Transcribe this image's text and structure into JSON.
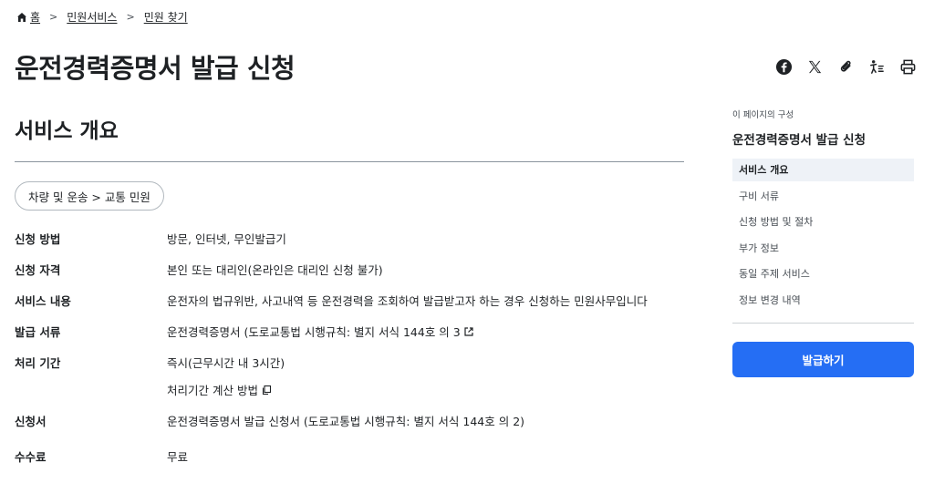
{
  "breadcrumb": {
    "home": "홈",
    "level1": "민원서비스",
    "level2": "민원 찾기"
  },
  "page_title": "운전경력증명서 발급 신청",
  "share_tools": [
    "facebook-icon",
    "x-icon",
    "link-icon",
    "accessibility-icon",
    "print-icon"
  ],
  "section_title": "서비스 개요",
  "category": "차량 및 운송 > 교통 민원",
  "info": {
    "method": {
      "label": "신청 방법",
      "value": "방문, 인터넷, 무인발급기"
    },
    "eligibility": {
      "label": "신청 자격",
      "value": "본인 또는 대리인(온라인은 대리인 신청 불가)"
    },
    "service": {
      "label": "서비스 내용",
      "value": "운전자의 법규위반, 사고내역 등 운전경력을 조회하여 발급받고자 하는 경우 신청하는 민원사무입니다"
    },
    "document": {
      "label": "발급 서류",
      "value": "운전경력증명서 (도로교통법 시행규칙: 별지 서식 144호 의 3"
    },
    "period": {
      "label": "처리 기간",
      "value": "즉시(근무시간 내 3시간)",
      "sub": "처리기간 계산 방법"
    },
    "application": {
      "label": "신청서",
      "value": "운전경력증명서 발급 신청서 (도로교통법 시행규칙: 별지 서식 144호 의 2)"
    },
    "fee": {
      "label": "수수료",
      "value": "무료"
    }
  },
  "toc": {
    "caption": "이 페이지의 구성",
    "title": "운전경력증명서 발급 신청",
    "items": [
      {
        "label": "서비스 개요",
        "active": true
      },
      {
        "label": "구비 서류"
      },
      {
        "label": "신청 방법 및 절차"
      },
      {
        "label": "부가 정보"
      },
      {
        "label": "동일 주제 서비스"
      },
      {
        "label": "정보 변경 내역"
      }
    ]
  },
  "apply_button": "발급하기",
  "colors": {
    "primary": "#256ef4",
    "text": "#1e2124",
    "active_bg": "#eef2f7"
  }
}
